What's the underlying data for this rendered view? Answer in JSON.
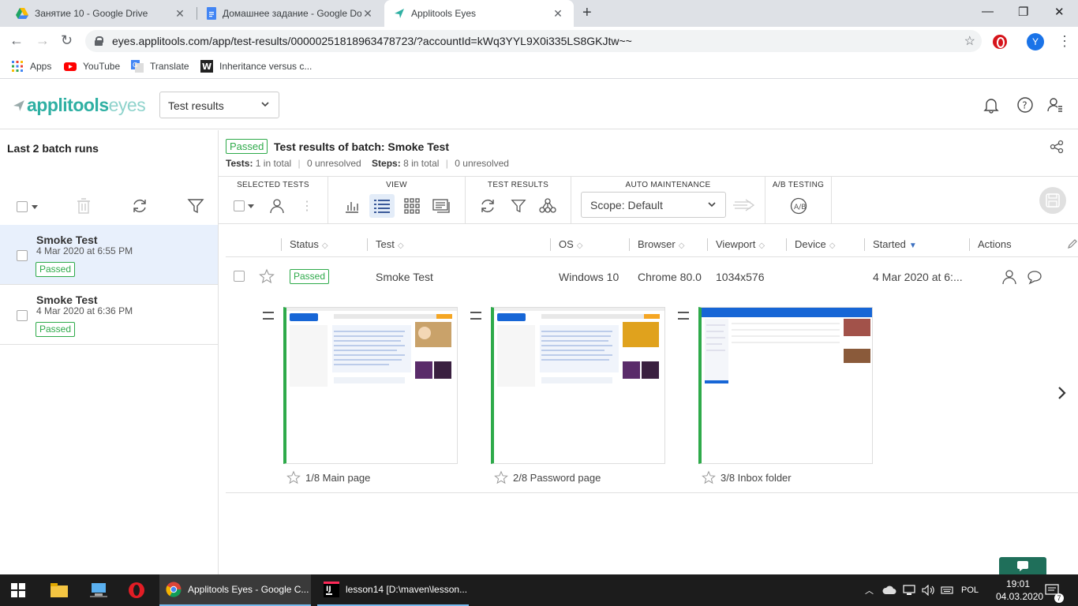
{
  "browser": {
    "tabs": [
      {
        "title": "Занятие 10 - Google Drive",
        "icon": "google-drive-icon"
      },
      {
        "title": "Домашнее задание - Google Do",
        "icon": "google-docs-icon"
      },
      {
        "title": "Applitools Eyes",
        "icon": "applitools-icon",
        "active": true
      }
    ],
    "url": "eyes.applitools.com/app/test-results/00000251818963478723/?accountId=kWq3YYL9X0i335LS8GKJtw~~",
    "profile_initial": "Y",
    "bookmarks": [
      {
        "label": "Apps",
        "icon": "apps-grid-icon"
      },
      {
        "label": "YouTube",
        "icon": "youtube-icon"
      },
      {
        "label": "Translate",
        "icon": "translate-icon"
      },
      {
        "label": "Inheritance versus c...",
        "icon": "bookmark-w-icon"
      }
    ]
  },
  "app": {
    "logo_main": "applitools",
    "logo_suffix": "eyes",
    "project_select": "Test results"
  },
  "left": {
    "title": "Last 2 batch runs",
    "batches": [
      {
        "name": "Smoke Test",
        "date": "4 Mar 2020 at 6:55 PM",
        "status": "Passed",
        "selected": true
      },
      {
        "name": "Smoke Test",
        "date": "4 Mar 2020 at 6:36 PM",
        "status": "Passed",
        "selected": false
      }
    ]
  },
  "batch": {
    "status": "Passed",
    "title": "Test results of batch:  Smoke Test",
    "tests_label": "Tests:",
    "tests_total": "1 in total",
    "tests_unresolved": "0 unresolved",
    "steps_label": "Steps:",
    "steps_total": "8 in total",
    "steps_unresolved": "0 unresolved"
  },
  "toolbar": {
    "selected_tests": "SELECTED TESTS",
    "view": "VIEW",
    "test_results": "TEST RESULTS",
    "auto_maintenance": "AUTO MAINTENANCE",
    "ab_testing": "A/B TESTING",
    "scope": "Scope: Default"
  },
  "table": {
    "headers": [
      "Status",
      "Test",
      "OS",
      "Browser",
      "Viewport",
      "Device",
      "Started",
      "Actions"
    ],
    "row": {
      "status": "Passed",
      "test": "Smoke Test",
      "os": "Windows 10",
      "browser": "Chrome 80.0",
      "viewport": "1034x576",
      "device": "",
      "started": "4 Mar 2020 at 6:..."
    }
  },
  "steps": [
    {
      "caption": "1/8 Main page"
    },
    {
      "caption": "2/8 Password page"
    },
    {
      "caption": "3/8 Inbox folder"
    }
  ],
  "taskbar": {
    "apps": [
      {
        "label": "Applitools Eyes - Google C...",
        "icon": "chrome-icon"
      },
      {
        "label": "lesson14 [D:\\maven\\lesson...",
        "icon": "intellij-icon"
      }
    ],
    "lang": "POL",
    "time": "19:01",
    "date": "04.03.2020",
    "notifications": "7"
  },
  "colors": {
    "accent_teal": "#2fb0a3",
    "pass_green": "#2eaa4a",
    "selected_row": "#e8f0fc"
  }
}
